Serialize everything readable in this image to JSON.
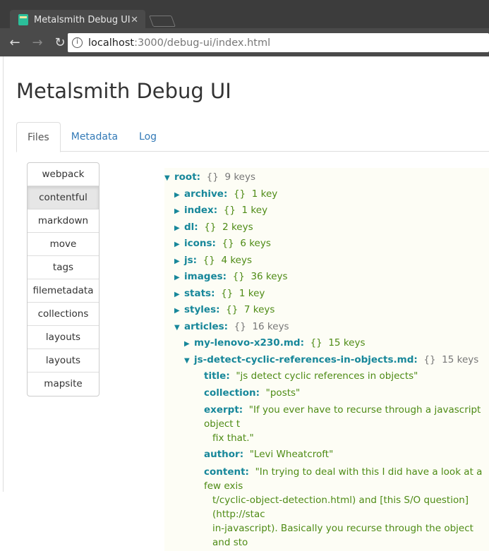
{
  "browser": {
    "tab_title": "Metalsmith Debug UI",
    "url_host": "localhost",
    "url_path": ":3000/debug-ui/index.html"
  },
  "page": {
    "title": "Metalsmith Debug UI",
    "tabs": [
      "Files",
      "Metadata",
      "Log"
    ]
  },
  "plugins": [
    "webpack",
    "contentful",
    "markdown",
    "move",
    "tags",
    "filemetadata",
    "collections",
    "layouts",
    "layouts",
    "mapsite"
  ],
  "tree": {
    "root": {
      "key": "root:",
      "type": "{}",
      "count": "9 keys"
    },
    "children": [
      {
        "key": "archive:",
        "count": "1 key"
      },
      {
        "key": "index:",
        "count": "1 key"
      },
      {
        "key": "dl:",
        "count": "2 keys"
      },
      {
        "key": "icons:",
        "count": "6 keys"
      },
      {
        "key": "js:",
        "count": "4 keys"
      },
      {
        "key": "images:",
        "count": "36 keys"
      },
      {
        "key": "stats:",
        "count": "1 key"
      },
      {
        "key": "styles:",
        "count": "7 keys"
      }
    ],
    "articles": {
      "key": "articles:",
      "count": "16 keys"
    },
    "article1": {
      "key": "my-lenovo-x230.md:",
      "count": "15 keys"
    },
    "article2": {
      "key": "js-detect-cyclic-references-in-objects.md:",
      "count": "15 keys"
    },
    "fields": {
      "title": {
        "key": "title:",
        "value": "\"js detect cyclic references in objects\""
      },
      "collection": {
        "key": "collection:",
        "value": "\"posts\""
      },
      "exerpt": {
        "key": "exerpt:",
        "value": "\"If you ever have to recurse through a javascript object t",
        "cont": "fix that.\""
      },
      "author": {
        "key": "author:",
        "value": "\"Levi Wheatcroft\""
      },
      "content": {
        "key": "content:",
        "value": "\"In trying to deal with this I did have a look at a few exis",
        "cont1": "t/cyclic-object-detection.html) and [this S/O question](http://stac",
        "cont2": "in-javascript). Basically you recurse through the object and sto"
      }
    }
  }
}
